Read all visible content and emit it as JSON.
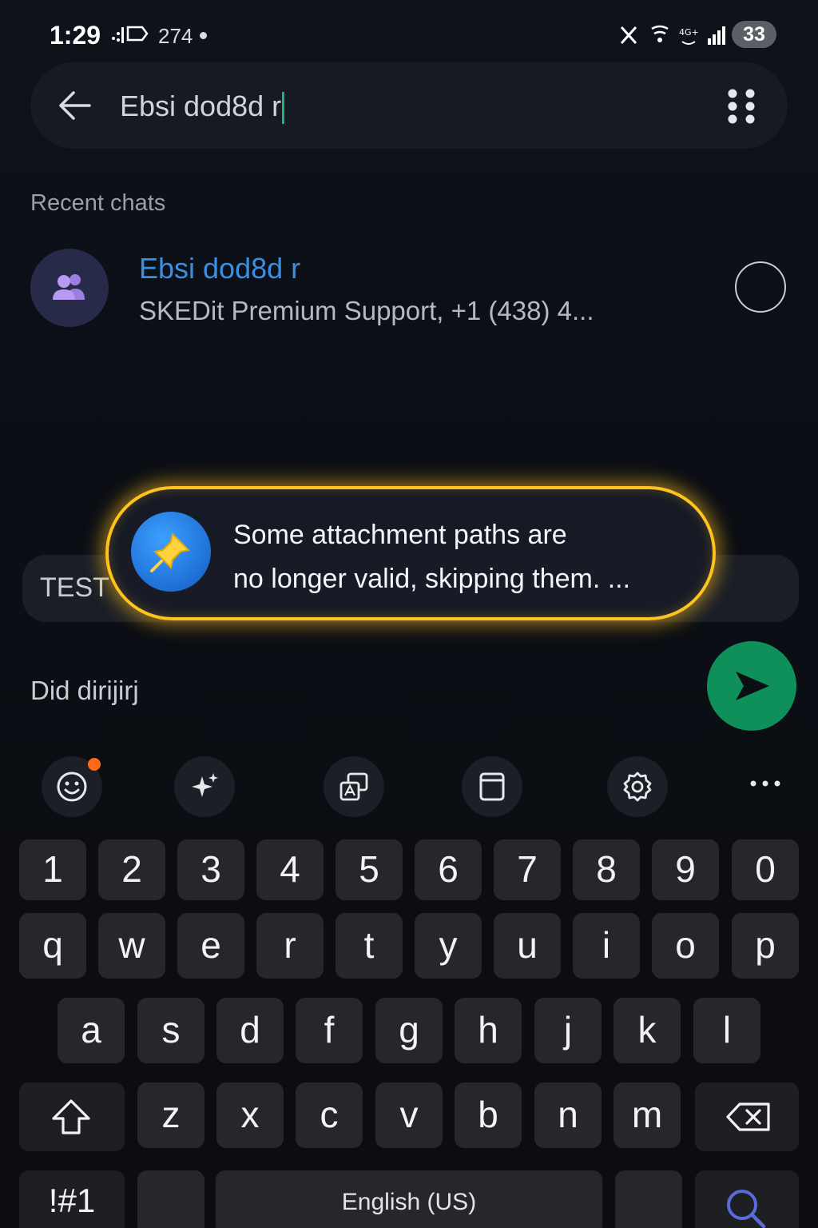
{
  "status_bar": {
    "time": "1:29",
    "notification_count": "274",
    "battery": "33"
  },
  "search": {
    "query": "Ebsi dod8d r"
  },
  "recent_chats": {
    "label": "Recent chats",
    "items": [
      {
        "name": "Ebsi dod8d r",
        "subtitle": "SKEDit Premium Support, +1 (438) 4..."
      }
    ]
  },
  "composer": {
    "caption": "TEST",
    "message": "Did dirijirj"
  },
  "toast": {
    "line1": "Some attachment paths are",
    "line2": "no longer valid, skipping them. ..."
  },
  "keyboard": {
    "number_row": [
      "1",
      "2",
      "3",
      "4",
      "5",
      "6",
      "7",
      "8",
      "9",
      "0"
    ],
    "row1": [
      "q",
      "w",
      "e",
      "r",
      "t",
      "y",
      "u",
      "i",
      "o",
      "p"
    ],
    "row2": [
      "a",
      "s",
      "d",
      "f",
      "g",
      "h",
      "j",
      "k",
      "l"
    ],
    "row3": [
      "z",
      "x",
      "c",
      "v",
      "b",
      "n",
      "m"
    ],
    "symbols_label": "!#1",
    "space_label": "English (US)"
  },
  "colors": {
    "accent_green": "#0f8f5a",
    "link_blue": "#3b8ee6",
    "toast_glow": "#ffc31f"
  }
}
